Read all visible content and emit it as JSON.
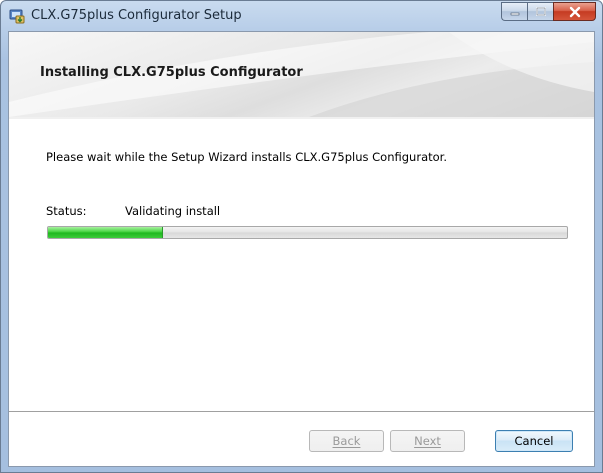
{
  "window": {
    "title": "CLX.G75plus Configurator Setup"
  },
  "banner": {
    "title": "Installing CLX.G75plus Configurator"
  },
  "main": {
    "description": "Please wait while the Setup Wizard installs CLX.G75plus Configurator.",
    "status_label": "Status:",
    "status_value": "Validating install",
    "progress_fraction": 0.22
  },
  "buttons": {
    "back": "Back",
    "next": "Next",
    "cancel": "Cancel"
  },
  "icons": {
    "app": "installer-icon",
    "minimize": "minimize-icon",
    "maximize": "maximize-icon",
    "close": "close-icon"
  },
  "colors": {
    "progress_fill": "#1fb81f",
    "close_button": "#c53b22",
    "titlebar": "#b7cde8"
  }
}
